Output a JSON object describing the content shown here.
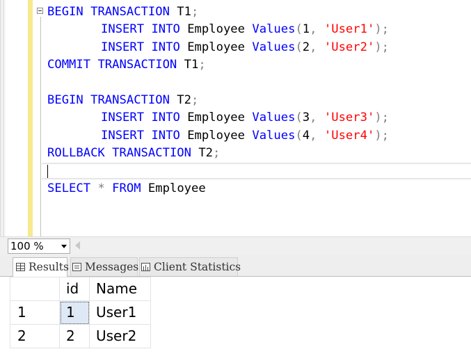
{
  "editor": {
    "lines": [
      [
        {
          "t": "BEGIN",
          "c": "kw"
        },
        {
          "t": " "
        },
        {
          "t": "TRANSACTION",
          "c": "kw"
        },
        {
          "t": " T1"
        },
        {
          "t": ";",
          "c": "pu"
        }
      ],
      [
        {
          "t": "INSERT",
          "c": "kw"
        },
        {
          "t": " "
        },
        {
          "t": "INTO",
          "c": "kw"
        },
        {
          "t": " Employee "
        },
        {
          "t": "Values",
          "c": "kw"
        },
        {
          "t": "(",
          "c": "pu"
        },
        {
          "t": "1"
        },
        {
          "t": ",",
          "c": "pu"
        },
        {
          "t": " "
        },
        {
          "t": "'User1'",
          "c": "str"
        },
        {
          "t": ");",
          "c": "pu"
        }
      ],
      [
        {
          "t": "INSERT",
          "c": "kw"
        },
        {
          "t": " "
        },
        {
          "t": "INTO",
          "c": "kw"
        },
        {
          "t": " Employee "
        },
        {
          "t": "Values",
          "c": "kw"
        },
        {
          "t": "(",
          "c": "pu"
        },
        {
          "t": "2"
        },
        {
          "t": ",",
          "c": "pu"
        },
        {
          "t": " "
        },
        {
          "t": "'User2'",
          "c": "str"
        },
        {
          "t": ");",
          "c": "pu"
        }
      ],
      [
        {
          "t": "COMMIT",
          "c": "kw"
        },
        {
          "t": " "
        },
        {
          "t": "TRANSACTION",
          "c": "kw"
        },
        {
          "t": " T1"
        },
        {
          "t": ";",
          "c": "pu"
        }
      ],
      [],
      [
        {
          "t": "BEGIN",
          "c": "kw"
        },
        {
          "t": " "
        },
        {
          "t": "TRANSACTION",
          "c": "kw"
        },
        {
          "t": " T2"
        },
        {
          "t": ";",
          "c": "pu"
        }
      ],
      [
        {
          "t": "INSERT",
          "c": "kw"
        },
        {
          "t": " "
        },
        {
          "t": "INTO",
          "c": "kw"
        },
        {
          "t": " Employee "
        },
        {
          "t": "Values",
          "c": "kw"
        },
        {
          "t": "(",
          "c": "pu"
        },
        {
          "t": "3"
        },
        {
          "t": ",",
          "c": "pu"
        },
        {
          "t": " "
        },
        {
          "t": "'User3'",
          "c": "str"
        },
        {
          "t": ");",
          "c": "pu"
        }
      ],
      [
        {
          "t": "INSERT",
          "c": "kw"
        },
        {
          "t": " "
        },
        {
          "t": "INTO",
          "c": "kw"
        },
        {
          "t": " Employee "
        },
        {
          "t": "Values",
          "c": "kw"
        },
        {
          "t": "(",
          "c": "pu"
        },
        {
          "t": "4"
        },
        {
          "t": ",",
          "c": "pu"
        },
        {
          "t": " "
        },
        {
          "t": "'User4'",
          "c": "str"
        },
        {
          "t": ");",
          "c": "pu"
        }
      ],
      [
        {
          "t": "ROLLBACK",
          "c": "kw"
        },
        {
          "t": " "
        },
        {
          "t": "TRANSACTION",
          "c": "kw"
        },
        {
          "t": " T2"
        },
        {
          "t": ";",
          "c": "pu"
        }
      ],
      [],
      [
        {
          "t": "SELECT",
          "c": "kw"
        },
        {
          "t": " "
        },
        {
          "t": "*",
          "c": "pu"
        },
        {
          "t": " "
        },
        {
          "t": "FROM",
          "c": "kw"
        },
        {
          "t": " Employee"
        }
      ]
    ]
  },
  "zoom": {
    "value": "100 %"
  },
  "tabs": {
    "results": "Results",
    "messages": "Messages",
    "client_statistics": "Client Statistics"
  },
  "grid": {
    "columns": [
      "id",
      "Name"
    ],
    "rows": [
      {
        "num": "1",
        "id": "1",
        "name": "User1"
      },
      {
        "num": "2",
        "id": "2",
        "name": "User2"
      }
    ]
  },
  "colors": {
    "keyword": "#0000ff",
    "string": "#ff0000",
    "punctuation": "#808080",
    "change_bar": "#f7e98e"
  }
}
